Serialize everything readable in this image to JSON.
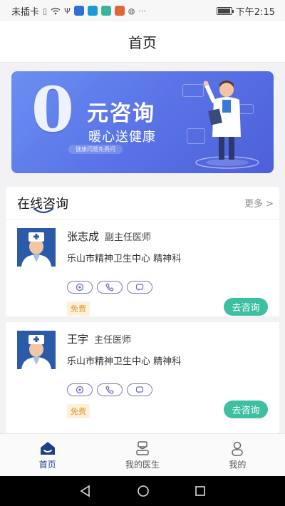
{
  "status_bar": {
    "carrier": "未插卡",
    "time": "下午2:15"
  },
  "header": {
    "title": "首页"
  },
  "banner": {
    "big_digit": "0",
    "title": "元咨询",
    "subtitle": "暖心送健康",
    "pill": "健康问题免费问"
  },
  "consult": {
    "title": "在线咨询",
    "more_label": "更多 >",
    "doctors": [
      {
        "name": "张志成",
        "title": "副主任医师",
        "hospital": "乐山市精神卫生中心 精神科",
        "badge": "免费",
        "button": "去咨询"
      },
      {
        "name": "王宇",
        "title": "主任医师",
        "hospital": "乐山市精神卫生中心 精神科",
        "badge": "免费",
        "button": "去咨询"
      }
    ]
  },
  "nav": [
    {
      "label": "首页",
      "icon": "home-icon",
      "active": true
    },
    {
      "label": "我的医生",
      "icon": "doctor-icon",
      "active": false
    },
    {
      "label": "我的",
      "icon": "person-icon",
      "active": false
    }
  ],
  "colors": {
    "accent": "#1f3f8c",
    "consult_button": "#3ec0a0",
    "free_badge": "#e39a2e",
    "banner": "#5b76e8"
  }
}
